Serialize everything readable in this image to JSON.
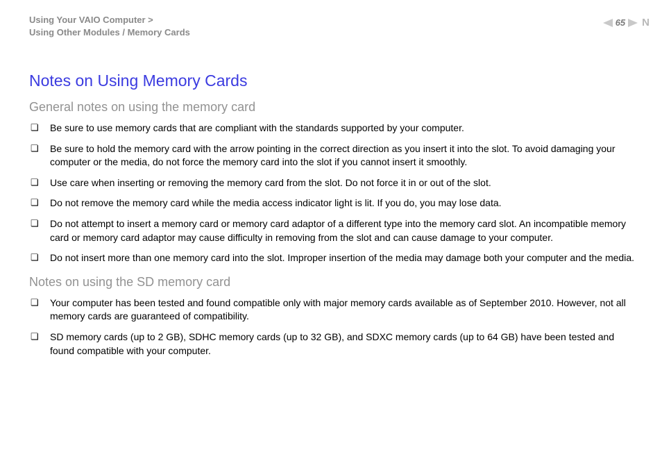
{
  "breadcrumb": {
    "line1": "Using Your VAIO Computer >",
    "line2": "Using Other Modules / Memory Cards"
  },
  "pageIndicator": {
    "number": "65",
    "trailing": "N"
  },
  "title": "Notes on Using Memory Cards",
  "sections": [
    {
      "heading": "General notes on using the memory card",
      "items": [
        "Be sure to use memory cards that are compliant with the standards supported by your computer.",
        "Be sure to hold the memory card with the arrow pointing in the correct direction as you insert it into the slot. To avoid damaging your computer or the media, do not force the memory card into the slot if you cannot insert it smoothly.",
        "Use care when inserting or removing the memory card from the slot. Do not force it in or out of the slot.",
        "Do not remove the memory card while the media access indicator light is lit. If you do, you may lose data.",
        "Do not attempt to insert a memory card or memory card adaptor of a different type into the memory card slot. An incompatible memory card or memory card adaptor may cause difficulty in removing from the slot and can cause damage to your computer.",
        "Do not insert more than one memory card into the slot. Improper insertion of the media may damage both your computer and the media."
      ]
    },
    {
      "heading": "Notes on using the SD memory card",
      "items": [
        "Your computer has been tested and found compatible only with major memory cards available as of September 2010. However, not all memory cards are guaranteed of compatibility.",
        "SD memory cards (up to 2 GB), SDHC memory cards (up to 32 GB), and SDXC memory cards (up to 64 GB) have been tested and found compatible with your computer."
      ]
    }
  ]
}
